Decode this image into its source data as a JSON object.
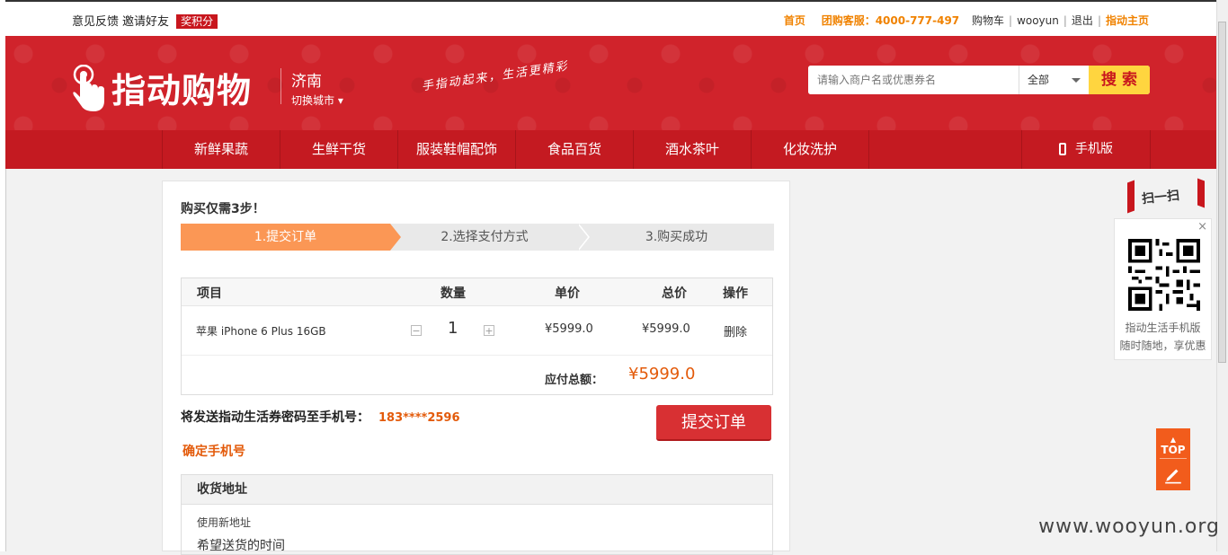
{
  "topbar": {
    "feedback": "意见反馈",
    "invite": "邀请好友",
    "points": "奖积分",
    "home": "首页",
    "hotline": "团购客服：4000-777-497",
    "cart": "购物车",
    "user": "wooyun",
    "logout": "退出",
    "main": "指动主页"
  },
  "header": {
    "logo_text": "指动购物",
    "city_name": "济南",
    "city_switch": "切换城市",
    "slogan": "手指动起来，生活更精彩",
    "search_placeholder": "请输入商户名或优惠券名",
    "search_scope": "全部",
    "search_button": "搜 索"
  },
  "nav": {
    "items": [
      "新鲜果蔬",
      "生鲜干货",
      "服装鞋帽配饰",
      "食品百货",
      "酒水茶叶",
      "化妆洗护"
    ],
    "mobile": "手机版"
  },
  "order": {
    "steps_title": "购买仅需3步！",
    "steps": [
      "1.提交订单",
      "2.选择支付方式",
      "3.购买成功"
    ],
    "table_headers": {
      "item": "项目",
      "qty": "数量",
      "unit": "单价",
      "total": "总价",
      "action": "操作"
    },
    "row": {
      "name": "苹果 iPhone 6 Plus 16GB",
      "minus": "−",
      "qty": "1",
      "plus": "+",
      "unit_price": "¥5999.0",
      "total_price": "¥5999.0",
      "delete": "删除"
    },
    "payable_label": "应付总额：",
    "payable_value": "¥5999.0",
    "phone_label": "将发送指动生活券密码至手机号：",
    "phone_number": "183****2596",
    "submit": "提交订单",
    "confirm_phone": "确定手机号",
    "address_title": "收货地址",
    "address_new": "使用新地址",
    "delivery_time": "希望送货的时间"
  },
  "side": {
    "scan": "扫一扫",
    "close": "×",
    "caption1": "指动生活手机版",
    "caption2": "随时随地，享优惠",
    "top": "TOP"
  },
  "watermark": "www.wooyun.org",
  "colors": {
    "brand_red": "#d0232b",
    "accent_orange": "#fb9755",
    "price_orange": "#e35a0a",
    "search_yellow": "#ffd53f"
  }
}
